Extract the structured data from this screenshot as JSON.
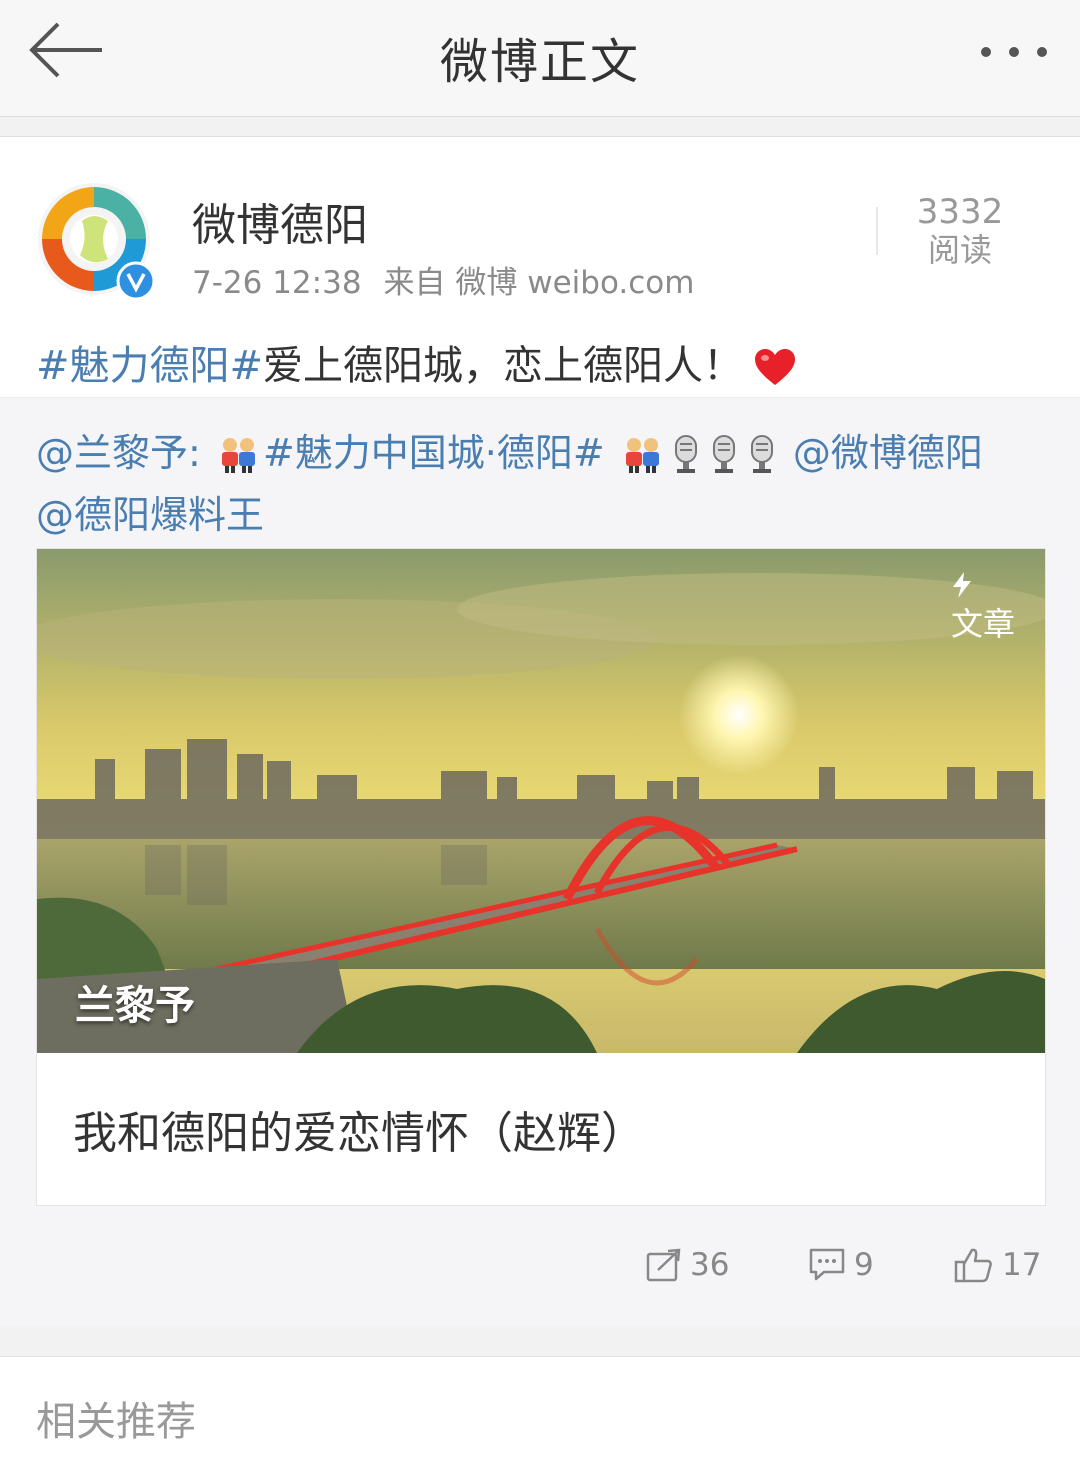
{
  "header": {
    "title": "微博正文"
  },
  "post": {
    "author": "微博德阳",
    "time": "7-26 12:38",
    "source": "来自 微博 weibo.com",
    "read_count": "3332",
    "read_label": "阅读",
    "topic": "#魅力德阳#",
    "text": "爱上德阳城，恋上德阳人！",
    "emoji": "heart-emoji"
  },
  "repost": {
    "user": "@兰黎予:",
    "topic": "#魅力中国城·德阳#",
    "mention_1": "@微博德阳",
    "mention_2": "@德阳爆料王",
    "emojis": [
      "people-emoji",
      "people-emoji",
      "microphone-emoji",
      "microphone-emoji",
      "microphone-emoji"
    ]
  },
  "article": {
    "badge": "文章",
    "photo_author": "兰黎予",
    "title": "我和德阳的爱恋情怀（赵辉）"
  },
  "actions": {
    "repost_count": "36",
    "comment_count": "9",
    "like_count": "17"
  },
  "recommend": {
    "title": "相关推荐"
  },
  "colors": {
    "link": "#4a7eb0",
    "verified": "#2f8fe0",
    "heart": "#e8202a",
    "bridge": "#e8332a"
  }
}
